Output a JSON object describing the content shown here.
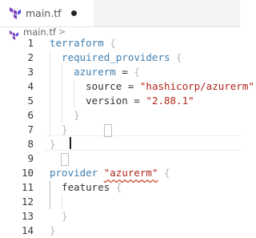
{
  "tab": {
    "title": "main.tf",
    "icon": "terraform-icon",
    "modified": true
  },
  "breadcrumb": {
    "file": "main.tf",
    "icon": "terraform-icon",
    "chevron": ">"
  },
  "colors": {
    "keyword": "#3f7fb0",
    "string": "#b0251b",
    "terraform_brand": "#7b42bc",
    "error_squiggle": "#c7452c"
  },
  "editor": {
    "lines": [
      {
        "n": "1",
        "segments": [
          {
            "t": "terraform",
            "c": "kw"
          },
          {
            "t": " {",
            "c": "brace"
          }
        ]
      },
      {
        "n": "2",
        "segments": [
          {
            "t": "  required_providers",
            "c": "kw"
          },
          {
            "t": " {",
            "c": "brace"
          }
        ]
      },
      {
        "n": "3",
        "segments": [
          {
            "t": "    azurerm",
            "c": "kw"
          },
          {
            "t": " = ",
            "c": ""
          },
          {
            "t": "{",
            "c": "brace"
          }
        ]
      },
      {
        "n": "4",
        "segments": [
          {
            "t": "      source",
            "c": ""
          },
          {
            "t": " = ",
            "c": ""
          },
          {
            "t": "\"hashicorp/azurerm\"",
            "c": "strq"
          }
        ]
      },
      {
        "n": "5",
        "segments": [
          {
            "t": "      version",
            "c": ""
          },
          {
            "t": " = ",
            "c": ""
          },
          {
            "t": "\"2.88.1\"",
            "c": "strq"
          }
        ]
      },
      {
        "n": "6",
        "segments": [
          {
            "t": "    }",
            "c": "brace"
          }
        ]
      },
      {
        "n": "7",
        "segments": [
          {
            "t": "  }",
            "c": "brace"
          }
        ]
      },
      {
        "n": "8",
        "segments": [
          {
            "t": "}",
            "c": "brace"
          }
        ]
      },
      {
        "n": "9",
        "segments": []
      },
      {
        "n": "10",
        "segments": [
          {
            "t": "provider",
            "c": "kw"
          },
          {
            "t": " ",
            "c": ""
          },
          {
            "t": "\"azurerm\"",
            "c": "strq squiggle"
          },
          {
            "t": " {",
            "c": "brace"
          }
        ]
      },
      {
        "n": "11",
        "segments": [
          {
            "t": "  features",
            "c": ""
          },
          {
            "t": " {",
            "c": "brace"
          }
        ]
      },
      {
        "n": "12",
        "segments": []
      },
      {
        "n": "13",
        "segments": [
          {
            "t": "  }",
            "c": "brace"
          }
        ]
      },
      {
        "n": "14",
        "segments": [
          {
            "t": "}",
            "c": "brace"
          }
        ]
      }
    ]
  }
}
